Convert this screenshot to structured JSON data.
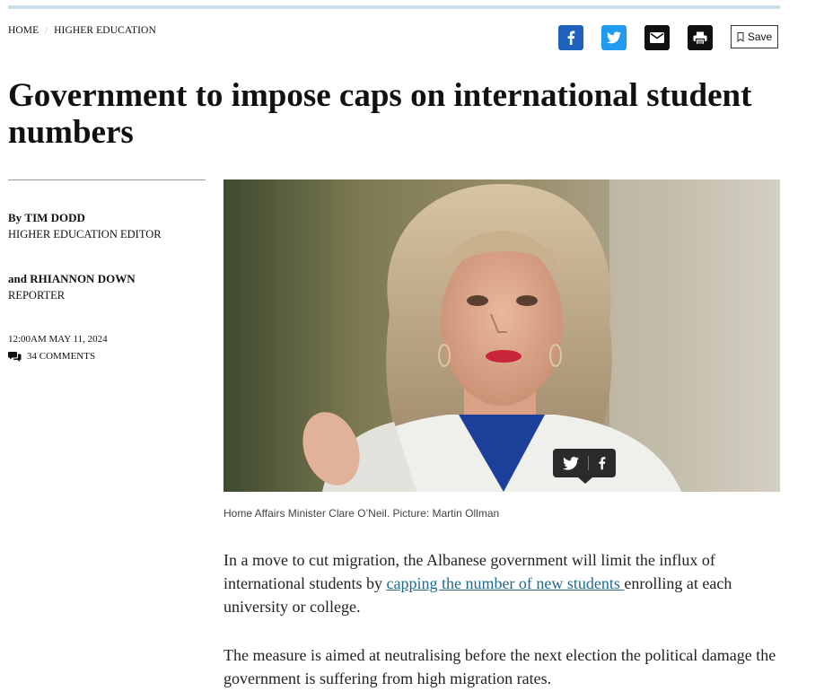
{
  "breadcrumb": {
    "home": "HOME",
    "separator": "/",
    "section": "HIGHER EDUCATION"
  },
  "share": {
    "facebook_icon": "facebook-icon",
    "twitter_icon": "twitter-icon",
    "email_icon": "email-icon",
    "print_icon": "print-icon",
    "save_label": "Save"
  },
  "headline": "Government to impose caps on international student numbers",
  "authors": [
    {
      "prefix": "By",
      "name": "TIM DODD",
      "role": "HIGHER EDUCATION EDITOR"
    },
    {
      "prefix": "and",
      "name": "RHIANNON DOWN",
      "role": "REPORTER"
    }
  ],
  "timestamp": "12:00AM MAY 11, 2024",
  "comments_label": "34 COMMENTS",
  "photo": {
    "caption": "Home Affairs Minister Clare O’Neil. Picture: Martin Ollman"
  },
  "body": {
    "p1_before": "In a move to cut migration, the Albanese government will limit the influx of international students by ",
    "p1_link": "capping the number of new students ",
    "p1_after": "enrolling at each university or college.",
    "p2": "The measure is aimed at neutralising before the next election the political damage the government is suffering from high migration rates."
  },
  "colors": {
    "facebook": "#1f62bb",
    "twitter": "#1f9bf0",
    "link": "#1f6a8a",
    "top_accent": "#c9e0ea"
  }
}
